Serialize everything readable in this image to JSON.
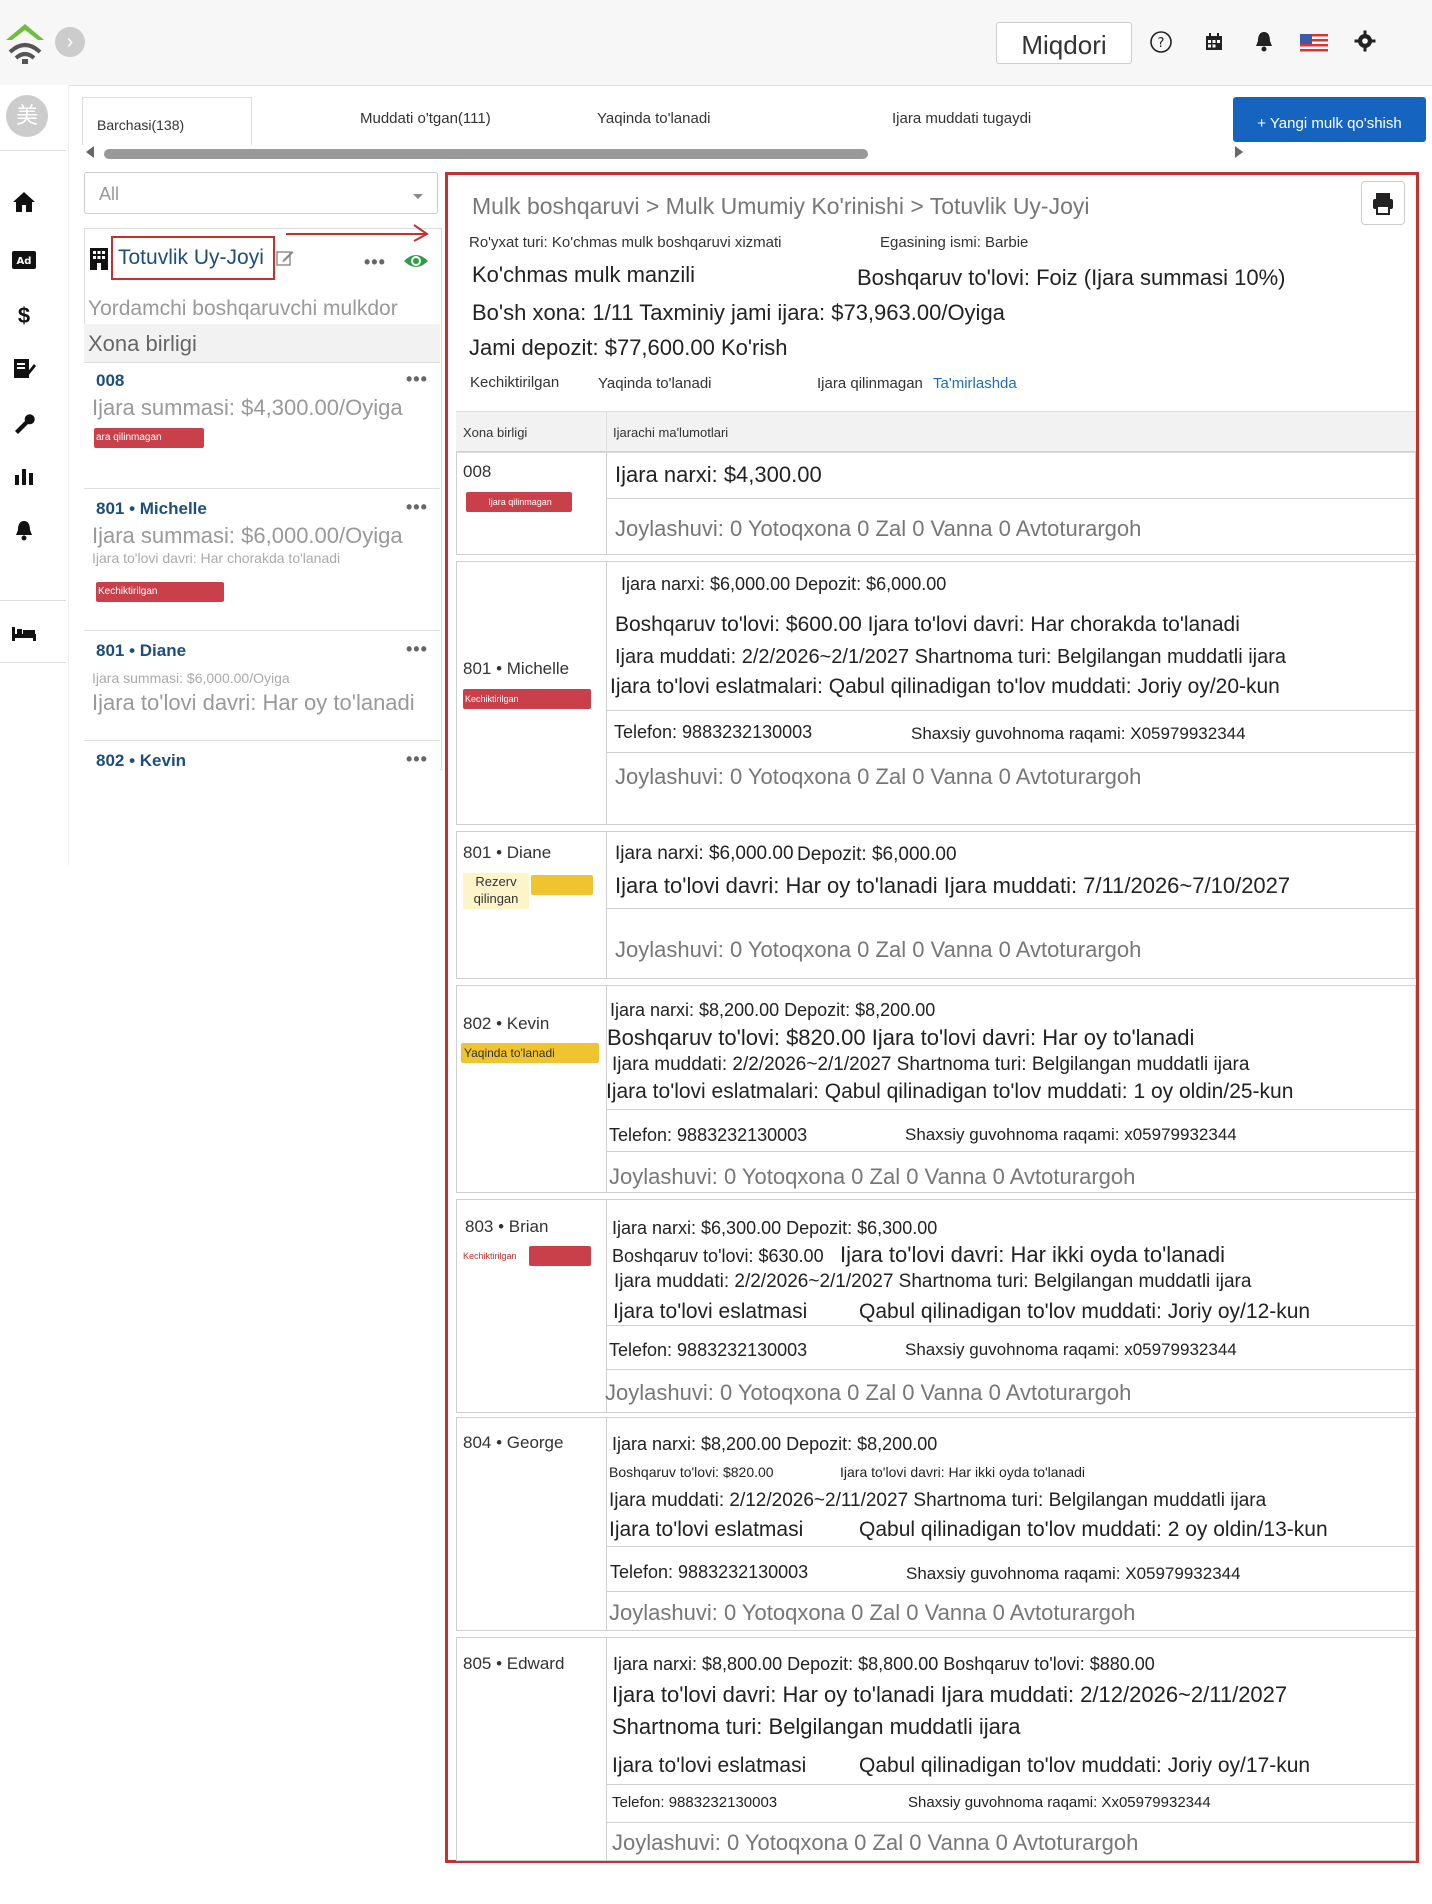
{
  "header": {
    "search_value": "Miqdori",
    "icons": [
      "help-icon",
      "calendar-icon",
      "bell-icon",
      "us-flag-icon",
      "gear-icon"
    ]
  },
  "sidebar": {
    "avatar_char": "美",
    "items": [
      "home-icon",
      "ad-icon",
      "dollar-icon",
      "contract-icon",
      "wrench-icon",
      "chart-icon",
      "bell-icon",
      "bed-icon"
    ]
  },
  "tabs": {
    "all": "Barchasi(138)",
    "overdue": "Muddati o'tgan(111)",
    "upcoming": "Yaqinda to'lanadi",
    "expired": "Ijara muddati tugaydi",
    "new_button": "+ Yangi mulk qo'shish"
  },
  "left": {
    "filter_value": "All",
    "property_title": "Totuvlik Uy-Joyi",
    "owner_role": "Yordamchi boshqaruvchi mulkdor",
    "section_label": "Xona birligi",
    "units": [
      {
        "head": "008",
        "line1": "Ijara summasi: $4,300.00/Oyiga",
        "badge": "ara qilinmagan"
      },
      {
        "head": "801 • Michelle",
        "line1": "Ijara summasi: $6,000.00/Oyiga",
        "line2": "Ijara to'lovi davri: Har chorakda to'lanadi",
        "badge": "Kechiktirilgan"
      },
      {
        "head": "801 • Diane",
        "line1": "Ijara summasi: $6,000.00/Oyiga",
        "line2": "Ijara to'lovi davri: Har oy to'lanadi"
      },
      {
        "head": "802 • Kevin"
      }
    ]
  },
  "main": {
    "breadcrumb": "Mulk boshqaruvi > Mulk Umumiy Ko'rinishi > Totuvlik Uy-Joyi",
    "list_type": "Ro'yxat turi: Ko'chmas mulk boshqaruvi xizmati",
    "owner_name": "Egasining ismi: Barbie",
    "address_label": "Ko'chmas mulk manzili",
    "management_fee": "Boshqaruv to'lovi: Foiz (Ijara summasi 10%)",
    "vacancy": "Bo'sh xona: 1/11 Taxminiy jami ijara: $73,963.00/Oyiga",
    "deposit_total": "Jami depozit: $77,600.00 Ko'rish",
    "filters": {
      "late": "Kechiktirilgan",
      "upcoming": "Yaqinda to'lanadi",
      "unrented": "Ijara qilinmagan",
      "repair": "Ta'mirlashda"
    },
    "col_unit": "Xona birligi",
    "col_tenant": "Ijarachi ma'lumotlari",
    "rows": [
      {
        "unit": "008",
        "badge": "Ijara qilinmagan",
        "l1": "Ijara narxi: $4,300.00",
        "layout": "Joylashuvi: 0 Yotoqxona 0 Zal 0 Vanna 0 Avtoturargoh"
      },
      {
        "unit": "801 • Michelle",
        "badge": "Kechiktirilgan",
        "l1": "Ijara narxi: $6,000.00 Depozit: $6,000.00",
        "l2": "Boshqaruv to'lovi: $600.00 Ijara to'lovi davri: Har chorakda to'lanadi",
        "l3": "Ijara muddati: 2/2/2026~2/1/2027 Shartnoma turi: Belgilangan muddatli ijara",
        "l4": "Ijara to'lovi eslatmalari: Qabul qilinadigan to'lov muddati: Joriy oy/20-kun",
        "phone": "Telefon: 9883232130003",
        "id": "Shaxsiy guvohnoma raqami: X05979932344",
        "layout": "Joylashuvi: 0 Yotoqxona 0 Zal 0 Vanna 0 Avtoturargoh"
      },
      {
        "unit": "801 • Diane",
        "badge": "Rezerv qilingan",
        "l1a": "Ijara narxi: $6,000.00",
        "l1b": "Depozit: $6,000.00",
        "l2": "Ijara to'lovi davri: Har oy to'lanadi Ijara muddati: 7/11/2026~7/10/2027",
        "layout": "Joylashuvi: 0 Yotoqxona 0 Zal 0 Vanna 0 Avtoturargoh"
      },
      {
        "unit": "802 • Kevin",
        "badge": "Yaqinda to'lanadi",
        "l1": "Ijara narxi: $8,200.00  Depozit: $8,200.00",
        "l2": "Boshqaruv to'lovi: $820.00 Ijara to'lovi davri: Har oy to'lanadi",
        "l3": "Ijara muddati: 2/2/2026~2/1/2027 Shartnoma turi: Belgilangan muddatli ijara",
        "l4": "Ijara to'lovi eslatmalari: Qabul qilinadigan to'lov muddati: 1 oy oldin/25-kun",
        "phone": "Telefon: 9883232130003",
        "id": "Shaxsiy guvohnoma raqami: x05979932344",
        "layout": "Joylashuvi: 0 Yotoqxona 0 Zal 0 Vanna 0 Avtoturargoh"
      },
      {
        "unit": "803 • Brian",
        "badge": "Kechiktirilgan",
        "l1": "Ijara narxi: $6,300.00  Depozit: $6,300.00",
        "l2a": "Boshqaruv to'lovi: $630.00",
        "l2b": "Ijara to'lovi davri: Har ikki oyda to'lanadi",
        "l3": "Ijara muddati: 2/2/2026~2/1/2027 Shartnoma turi: Belgilangan muddatli ijara",
        "l4a": "Ijara to'lovi eslatmasi",
        "l4b": "Qabul qilinadigan to'lov muddati: Joriy oy/12-kun",
        "phone": "Telefon: 9883232130003",
        "id": "Shaxsiy guvohnoma raqami: x05979932344",
        "layout": "Joylashuvi: 0 Yotoqxona 0 Zal 0 Vanna 0 Avtoturargoh"
      },
      {
        "unit": "804 • George",
        "l1": "Ijara narxi: $8,200.00  Depozit: $8,200.00",
        "l2a": "Boshqaruv to'lovi: $820.00",
        "l2b": "Ijara to'lovi davri: Har ikki oyda to'lanadi",
        "l3": "Ijara muddati: 2/12/2026~2/11/2027 Shartnoma turi: Belgilangan muddatli ijara",
        "l4a": "Ijara to'lovi eslatmasi",
        "l4b": "Qabul qilinadigan to'lov muddati: 2 oy oldin/13-kun",
        "phone": "Telefon: 9883232130003",
        "id": "Shaxsiy guvohnoma raqami: X05979932344",
        "layout": "Joylashuvi: 0 Yotoqxona 0 Zal 0 Vanna 0 Avtoturargoh"
      },
      {
        "unit": "805 • Edward",
        "l1": "Ijara narxi: $8,800.00 Depozit: $8,800.00 Boshqaruv to'lovi: $880.00",
        "l2": "Ijara to'lovi davri: Har oy to'lanadi Ijara muddati: 2/12/2026~2/11/2027",
        "l3": "Shartnoma turi: Belgilangan muddatli ijara",
        "l4a": "Ijara to'lovi eslatmasi",
        "l4b": "Qabul qilinadigan to'lov muddati: Joriy oy/17-kun",
        "phone": "Telefon: 9883232130003",
        "id": "Shaxsiy guvohnoma raqami: Xx05979932344",
        "layout": "Joylashuvi: 0 Yotoqxona 0 Zal 0 Vanna 0 Avtoturargoh"
      }
    ]
  },
  "colors": {
    "accent_red": "#c53030",
    "badge_red": "#c9404b",
    "badge_yellow": "#f0c330",
    "primary_blue": "#1565c0",
    "eye_green": "#2e9e44"
  }
}
